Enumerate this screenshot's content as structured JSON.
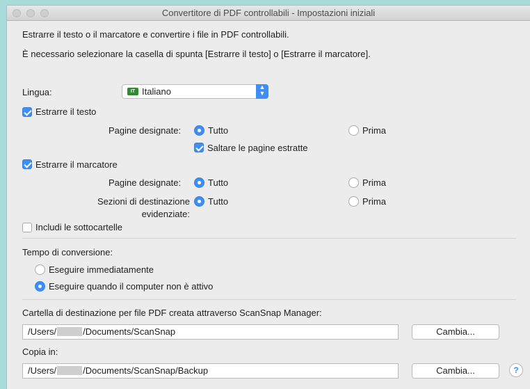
{
  "window": {
    "title": "Convertitore di PDF controllabili - Impostazioni iniziali"
  },
  "intro": {
    "line1": "Estrarre il testo o il marcatore e convertire i file in PDF controllabili.",
    "line2": "È necessario selezionare la casella di spunta [Estrarre il testo] o [Estrarre il marcatore]."
  },
  "language": {
    "label": "Lingua:",
    "flag_code": "IT",
    "selected": "Italiano"
  },
  "extract_text": {
    "label": "Estrarre il testo",
    "checked": true,
    "pages_label": "Pagine designate:",
    "option_all": "Tutto",
    "option_first": "Prima",
    "selected": "Tutto",
    "skip_label": "Saltare le pagine estratte",
    "skip_checked": true
  },
  "extract_marker": {
    "label": "Estrarre il marcatore",
    "checked": true,
    "pages_label": "Pagine designate:",
    "pages_all": "Tutto",
    "pages_first": "Prima",
    "pages_selected": "Tutto",
    "sections_label_line1": "Sezioni di destinazione",
    "sections_label_line2": "evidenziate:",
    "sections_all": "Tutto",
    "sections_first": "Prima",
    "sections_selected": "Tutto"
  },
  "subfolders": {
    "label": "Includi le sottocartelle",
    "checked": false
  },
  "conversion_time": {
    "label": "Tempo di conversione:",
    "option_now": "Eseguire immediatamente",
    "option_idle": "Eseguire quando il computer non è attivo",
    "selected": "Eseguire quando il computer non è attivo"
  },
  "destination": {
    "label": "Cartella di destinazione per file PDF creata attraverso ScanSnap Manager:",
    "path_prefix": "/Users/",
    "path_suffix": "/Documents/ScanSnap",
    "button": "Cambia..."
  },
  "copy": {
    "label": "Copia in:",
    "path_prefix": "/Users/",
    "path_suffix": "/Documents/ScanSnap/Backup",
    "button": "Cambia..."
  },
  "help": {
    "glyph": "?",
    "icon": "help-icon"
  },
  "colors": {
    "accent": "#3f8ef5",
    "window_bg": "#ececec",
    "desktop_bg": "#a9dcd9"
  }
}
